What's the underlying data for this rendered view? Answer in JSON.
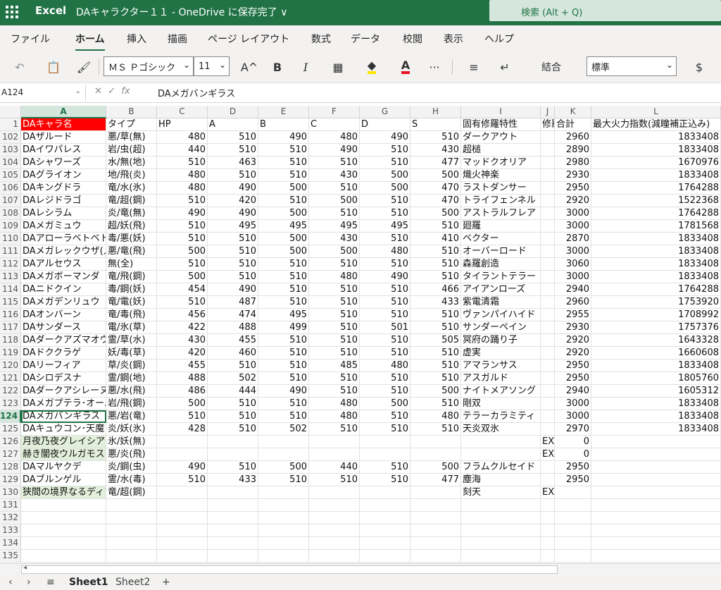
{
  "titlebar": {
    "app": "Excel",
    "doc": "DAキャラクター１１ - OneDrive に保存完了 ∨",
    "search": "検索 (Alt + Q)"
  },
  "menu": [
    "ファイル",
    "ホーム",
    "挿入",
    "描画",
    "ページ レイアウト",
    "数式",
    "データ",
    "校閲",
    "表示",
    "ヘルプ"
  ],
  "toolbar": {
    "font": "ＭＳ Ｐゴシック",
    "size": "11",
    "merge": "結合",
    "numfmt": "標準",
    "icons": {
      "undo": "↶",
      "paste": "📋",
      "brush": "🖌",
      "grow": "A^",
      "bold": "B",
      "italic": "I",
      "border": "▦",
      "more": "···",
      "align": "≡",
      "wrap": "↵",
      "currency": "$"
    }
  },
  "formulabar": {
    "cell": "A124",
    "fx": "fx",
    "value": "DAメガバンギラス"
  },
  "columns": [
    "A",
    "B",
    "C",
    "D",
    "E",
    "F",
    "G",
    "H",
    "I",
    "J",
    "K",
    "L"
  ],
  "selected_column": "A",
  "selected_row": "124",
  "rows": [
    {
      "n": "1",
      "c": [
        "DAキャラ名",
        "タイプ",
        "HP",
        "A",
        "B",
        "C",
        "D",
        "S",
        "固有修羅特性",
        "修羅",
        "合計",
        "最大火力指数(減瞳補正込み)"
      ]
    },
    {
      "n": "102",
      "c": [
        "DAザルード",
        "悪/草(無)",
        "480",
        "510",
        "490",
        "480",
        "490",
        "510",
        "ダークアウト",
        "",
        "2960",
        "1833408"
      ]
    },
    {
      "n": "103",
      "c": [
        "DAイワパレス",
        "岩/虫(超)",
        "440",
        "510",
        "510",
        "490",
        "510",
        "430",
        "超槌",
        "",
        "2890",
        "1833408"
      ]
    },
    {
      "n": "104",
      "c": [
        "DAシャワーズ",
        "水/無(地)",
        "510",
        "463",
        "510",
        "510",
        "510",
        "477",
        "マッドクオリア",
        "",
        "2980",
        "1670976"
      ]
    },
    {
      "n": "105",
      "c": [
        "DAグライオン",
        "地/飛(炎)",
        "480",
        "510",
        "510",
        "430",
        "500",
        "500",
        "熾火神楽",
        "",
        "2930",
        "1833408"
      ]
    },
    {
      "n": "106",
      "c": [
        "DAキングドラ",
        "竜/水(氷)",
        "480",
        "490",
        "500",
        "510",
        "500",
        "470",
        "ラストダンサー",
        "",
        "2950",
        "1764288"
      ]
    },
    {
      "n": "107",
      "c": [
        "DAレジドラゴ",
        "竜/超(鋼)",
        "510",
        "420",
        "510",
        "500",
        "510",
        "470",
        "トライフェンネル",
        "",
        "2920",
        "1522368"
      ]
    },
    {
      "n": "108",
      "c": [
        "DAレシラム",
        "炎/竜(無)",
        "490",
        "490",
        "500",
        "510",
        "510",
        "500",
        "アストラルフレア",
        "",
        "3000",
        "1764288"
      ]
    },
    {
      "n": "109",
      "c": [
        "DAメガミュウ",
        "超/妖(飛)",
        "510",
        "495",
        "495",
        "495",
        "495",
        "510",
        "廻羅",
        "",
        "3000",
        "1781568"
      ]
    },
    {
      "n": "110",
      "c": [
        "DAアローラベトベトン",
        "毒/悪(妖)",
        "510",
        "510",
        "500",
        "430",
        "510",
        "410",
        "ベクター",
        "",
        "2870",
        "1833408"
      ]
    },
    {
      "n": "111",
      "c": [
        "DAメガレックウザ(人)",
        "悪/竜(飛)",
        "500",
        "510",
        "500",
        "500",
        "480",
        "510",
        "オーバーロード",
        "",
        "3000",
        "1833408"
      ]
    },
    {
      "n": "112",
      "c": [
        "DAアルセウス",
        "無(全)",
        "510",
        "510",
        "510",
        "510",
        "510",
        "510",
        "森羅創造",
        "",
        "3060",
        "1833408"
      ]
    },
    {
      "n": "113",
      "c": [
        "DAメガボーマンダ",
        "竜/飛(鋼)",
        "500",
        "510",
        "510",
        "480",
        "490",
        "510",
        "タイラントテラー",
        "",
        "3000",
        "1833408"
      ]
    },
    {
      "n": "114",
      "c": [
        "DAニドクイン",
        "毒/鋼(妖)",
        "454",
        "490",
        "510",
        "510",
        "510",
        "466",
        "アイアンローズ",
        "",
        "2940",
        "1764288"
      ]
    },
    {
      "n": "115",
      "c": [
        "DAメガデンリュウ",
        "竜/電(妖)",
        "510",
        "487",
        "510",
        "510",
        "510",
        "433",
        "紫電清霜",
        "",
        "2960",
        "1753920"
      ]
    },
    {
      "n": "116",
      "c": [
        "DAオンバーン",
        "竜/毒(飛)",
        "456",
        "474",
        "495",
        "510",
        "510",
        "510",
        "ヴァンパイハイド",
        "",
        "2955",
        "1708992"
      ]
    },
    {
      "n": "117",
      "c": [
        "DAサンダース",
        "電/氷(草)",
        "422",
        "488",
        "499",
        "510",
        "501",
        "510",
        "サンダーペイン",
        "",
        "2930",
        "1757376"
      ]
    },
    {
      "n": "118",
      "c": [
        "DAダークアズマオウ",
        "霊/草(水)",
        "430",
        "455",
        "510",
        "510",
        "510",
        "505",
        "冥府の踊り子",
        "",
        "2920",
        "1643328"
      ]
    },
    {
      "n": "119",
      "c": [
        "DAドククラゲ",
        "妖/毒(草)",
        "420",
        "460",
        "510",
        "510",
        "510",
        "510",
        "虚実",
        "",
        "2920",
        "1660608"
      ]
    },
    {
      "n": "120",
      "c": [
        "DAリーフィア",
        "草/炎(鋼)",
        "455",
        "510",
        "510",
        "485",
        "480",
        "510",
        "アマランサス",
        "",
        "2950",
        "1833408"
      ]
    },
    {
      "n": "121",
      "c": [
        "DAシロデスナ",
        "霊/鋼(地)",
        "488",
        "502",
        "510",
        "510",
        "510",
        "510",
        "アスガルド",
        "",
        "2950",
        "1805760"
      ]
    },
    {
      "n": "122",
      "c": [
        "DAダークアシレーヌ",
        "悪/水(飛)",
        "486",
        "444",
        "490",
        "510",
        "510",
        "500",
        "ナイトメアソング",
        "",
        "2940",
        "1605312"
      ]
    },
    {
      "n": "123",
      "c": [
        "DAメガプテラ･オーバー",
        "岩/飛(鋼)",
        "500",
        "510",
        "510",
        "480",
        "500",
        "510",
        "剛双",
        "",
        "3000",
        "1833408"
      ]
    },
    {
      "n": "124",
      "c": [
        "DAメガバンギラス",
        "悪/岩(竜)",
        "510",
        "510",
        "510",
        "480",
        "510",
        "480",
        "テラーカラミティ",
        "",
        "3000",
        "1833408"
      ]
    },
    {
      "n": "125",
      "c": [
        "DAキュウコン･天魔",
        "炎/妖(氷)",
        "428",
        "510",
        "502",
        "510",
        "510",
        "510",
        "天炎双氷",
        "",
        "2970",
        "1833408"
      ]
    },
    {
      "n": "126",
      "c": [
        "月夜乃夜グレイシア",
        "氷/妖(無)",
        "",
        "",
        "",
        "",
        "",
        "",
        "",
        "EX",
        "0",
        ""
      ]
    },
    {
      "n": "127",
      "c": [
        "赫き闇夜ウルガモス",
        "悪/炎(飛)",
        "",
        "",
        "",
        "",
        "",
        "",
        "",
        "EX",
        "0",
        ""
      ]
    },
    {
      "n": "128",
      "c": [
        "DAマルヤクデ",
        "炎/鋼(虫)",
        "490",
        "510",
        "500",
        "440",
        "510",
        "500",
        "フラムクルセイド",
        "",
        "2950",
        ""
      ]
    },
    {
      "n": "129",
      "c": [
        "DAブルンゲル",
        "霊/水(毒)",
        "510",
        "433",
        "510",
        "510",
        "510",
        "477",
        "塵海",
        "",
        "2950",
        ""
      ]
    },
    {
      "n": "130",
      "c": [
        "狭間の境界なるディアルガ",
        "竜/超(鋼)",
        "",
        "",
        "",
        "",
        "",
        "",
        "刻天",
        "EX",
        "",
        ""
      ]
    },
    {
      "n": "131",
      "c": [
        "",
        "",
        "",
        "",
        "",
        "",
        "",
        "",
        "",
        "",
        "",
        ""
      ]
    },
    {
      "n": "132",
      "c": [
        "",
        "",
        "",
        "",
        "",
        "",
        "",
        "",
        "",
        "",
        "",
        ""
      ]
    },
    {
      "n": "133",
      "c": [
        "",
        "",
        "",
        "",
        "",
        "",
        "",
        "",
        "",
        "",
        "",
        ""
      ]
    },
    {
      "n": "134",
      "c": [
        "",
        "",
        "",
        "",
        "",
        "",
        "",
        "",
        "",
        "",
        "",
        ""
      ]
    },
    {
      "n": "135",
      "c": [
        "",
        "",
        "",
        "",
        "",
        "",
        "",
        "",
        "",
        "",
        "",
        ""
      ]
    }
  ],
  "sheets": {
    "nav_prev": "‹",
    "nav_next": "›",
    "all": "≡",
    "tabs": [
      "Sheet1",
      "Sheet2"
    ],
    "add": "+"
  }
}
